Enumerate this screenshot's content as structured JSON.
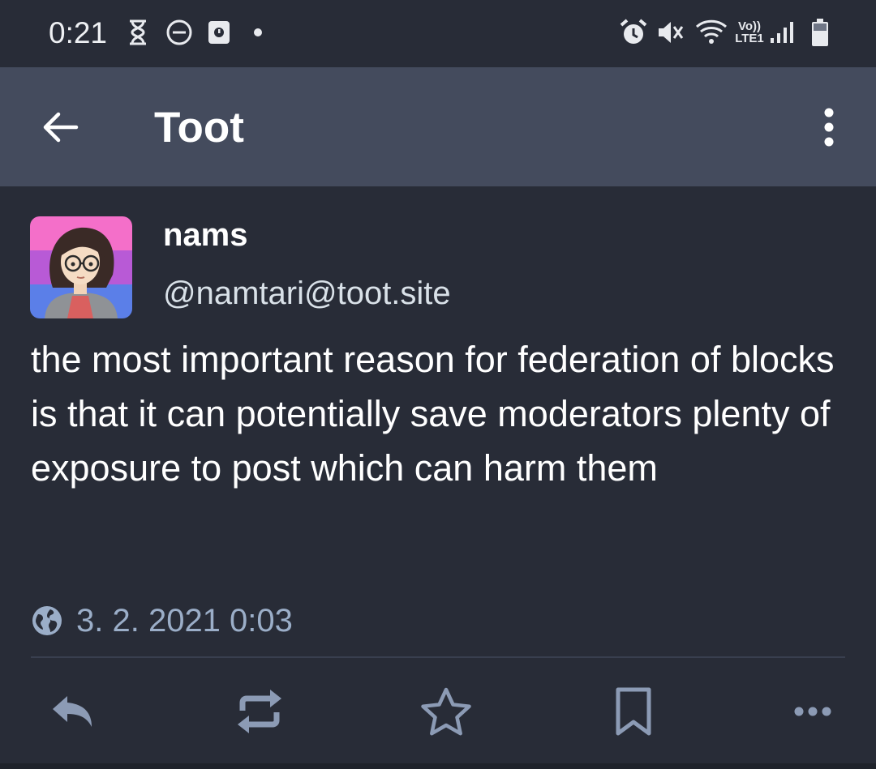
{
  "status_bar": {
    "time": "0:21",
    "left_icons": [
      "hourglass-icon",
      "do-not-disturb-icon",
      "screen-time-icon",
      "notification-dot-icon"
    ],
    "right_icons": [
      "alarm-icon",
      "vibrate-mute-icon",
      "wifi-icon",
      "volte-icon",
      "signal-icon",
      "battery-icon"
    ],
    "volte_label": "Vo))",
    "lte_label": "LTE1"
  },
  "app_bar": {
    "title": "Toot",
    "back_icon": "arrow-left-icon",
    "menu_icon": "more-vertical-icon"
  },
  "post": {
    "display_name": "nams",
    "handle": "@namtari@toot.site",
    "content": "the most important reason for federation of blocks is that it can potentially save moderators plenty of exposure to post which can harm them",
    "visibility_icon": "globe-icon",
    "timestamp": "3. 2. 2021 0:03"
  },
  "actions": [
    {
      "name": "reply",
      "icon": "reply-icon"
    },
    {
      "name": "boost",
      "icon": "repeat-icon"
    },
    {
      "name": "favourite",
      "icon": "star-icon"
    },
    {
      "name": "bookmark",
      "icon": "bookmark-icon"
    },
    {
      "name": "more",
      "icon": "more-horizontal-icon"
    }
  ],
  "colors": {
    "background": "#282c37",
    "app_bar": "#444b5d",
    "secondary_text": "#9baec8",
    "icon": "#8c9bb5",
    "avatar_stripes": [
      "#f46fc9",
      "#b85ad6",
      "#5b7fe8"
    ]
  }
}
